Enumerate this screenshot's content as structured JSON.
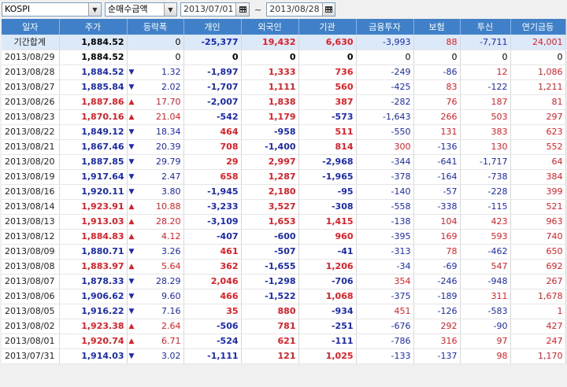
{
  "toolbar": {
    "market": "KOSPI",
    "metric": "순매수금액",
    "start_date": "2013/07/01",
    "end_date": "2013/08/28",
    "range_sep": "~"
  },
  "columns": [
    "일자",
    "주가",
    "등락폭",
    "개인",
    "외국인",
    "기관",
    "금융투자",
    "보험",
    "투신",
    "연기금등"
  ],
  "rows": [
    {
      "date": "기간합계",
      "price": "1,884.52",
      "dir": "",
      "chg": "0",
      "ind": "-25,377",
      "frn": "19,432",
      "inst": "6,630",
      "fin": "-3,993",
      "ins": "88",
      "trust": "-7,711",
      "pen": "24,001",
      "sum": true
    },
    {
      "date": "2013/08/29",
      "price": "1,884.52",
      "dir": "",
      "chg": "0",
      "ind": "0",
      "frn": "0",
      "inst": "0",
      "fin": "0",
      "ins": "0",
      "trust": "0",
      "pen": "0"
    },
    {
      "date": "2013/08/28",
      "price": "1,884.52",
      "dir": "d",
      "chg": "1.32",
      "ind": "-1,897",
      "frn": "1,333",
      "inst": "736",
      "fin": "-249",
      "ins": "-86",
      "trust": "12",
      "pen": "1,086"
    },
    {
      "date": "2013/08/27",
      "price": "1,885.84",
      "dir": "d",
      "chg": "2.02",
      "ind": "-1,707",
      "frn": "1,111",
      "inst": "560",
      "fin": "-425",
      "ins": "83",
      "trust": "-122",
      "pen": "1,211"
    },
    {
      "date": "2013/08/26",
      "price": "1,887.86",
      "dir": "u",
      "chg": "17.70",
      "ind": "-2,007",
      "frn": "1,838",
      "inst": "387",
      "fin": "-282",
      "ins": "76",
      "trust": "187",
      "pen": "81"
    },
    {
      "date": "2013/08/23",
      "price": "1,870.16",
      "dir": "u",
      "chg": "21.04",
      "ind": "-542",
      "frn": "1,179",
      "inst": "-573",
      "fin": "-1,643",
      "ins": "266",
      "trust": "503",
      "pen": "297"
    },
    {
      "date": "2013/08/22",
      "price": "1,849.12",
      "dir": "d",
      "chg": "18.34",
      "ind": "464",
      "frn": "-958",
      "inst": "511",
      "fin": "-550",
      "ins": "131",
      "trust": "383",
      "pen": "623"
    },
    {
      "date": "2013/08/21",
      "price": "1,867.46",
      "dir": "d",
      "chg": "20.39",
      "ind": "708",
      "frn": "-1,400",
      "inst": "814",
      "fin": "300",
      "ins": "-136",
      "trust": "130",
      "pen": "552"
    },
    {
      "date": "2013/08/20",
      "price": "1,887.85",
      "dir": "d",
      "chg": "29.79",
      "ind": "29",
      "frn": "2,997",
      "inst": "-2,968",
      "fin": "-344",
      "ins": "-641",
      "trust": "-1,717",
      "pen": "64"
    },
    {
      "date": "2013/08/19",
      "price": "1,917.64",
      "dir": "d",
      "chg": "2.47",
      "ind": "658",
      "frn": "1,287",
      "inst": "-1,965",
      "fin": "-378",
      "ins": "-164",
      "trust": "-738",
      "pen": "384"
    },
    {
      "date": "2013/08/16",
      "price": "1,920.11",
      "dir": "d",
      "chg": "3.80",
      "ind": "-1,945",
      "frn": "2,180",
      "inst": "-95",
      "fin": "-140",
      "ins": "-57",
      "trust": "-228",
      "pen": "399"
    },
    {
      "date": "2013/08/14",
      "price": "1,923.91",
      "dir": "u",
      "chg": "10.88",
      "ind": "-3,233",
      "frn": "3,527",
      "inst": "-308",
      "fin": "-558",
      "ins": "-338",
      "trust": "-115",
      "pen": "521"
    },
    {
      "date": "2013/08/13",
      "price": "1,913.03",
      "dir": "u",
      "chg": "28.20",
      "ind": "-3,109",
      "frn": "1,653",
      "inst": "1,415",
      "fin": "-138",
      "ins": "104",
      "trust": "423",
      "pen": "963"
    },
    {
      "date": "2013/08/12",
      "price": "1,884.83",
      "dir": "u",
      "chg": "4.12",
      "ind": "-407",
      "frn": "-600",
      "inst": "960",
      "fin": "-395",
      "ins": "169",
      "trust": "593",
      "pen": "740"
    },
    {
      "date": "2013/08/09",
      "price": "1,880.71",
      "dir": "d",
      "chg": "3.26",
      "ind": "461",
      "frn": "-507",
      "inst": "-41",
      "fin": "-313",
      "ins": "78",
      "trust": "-462",
      "pen": "650"
    },
    {
      "date": "2013/08/08",
      "price": "1,883.97",
      "dir": "u",
      "chg": "5.64",
      "ind": "362",
      "frn": "-1,655",
      "inst": "1,206",
      "fin": "-34",
      "ins": "-69",
      "trust": "547",
      "pen": "692"
    },
    {
      "date": "2013/08/07",
      "price": "1,878.33",
      "dir": "d",
      "chg": "28.29",
      "ind": "2,046",
      "frn": "-1,298",
      "inst": "-706",
      "fin": "354",
      "ins": "-246",
      "trust": "-948",
      "pen": "267"
    },
    {
      "date": "2013/08/06",
      "price": "1,906.62",
      "dir": "d",
      "chg": "9.60",
      "ind": "466",
      "frn": "-1,522",
      "inst": "1,068",
      "fin": "-375",
      "ins": "-189",
      "trust": "311",
      "pen": "1,678"
    },
    {
      "date": "2013/08/05",
      "price": "1,916.22",
      "dir": "d",
      "chg": "7.16",
      "ind": "35",
      "frn": "880",
      "inst": "-934",
      "fin": "451",
      "ins": "-126",
      "trust": "-583",
      "pen": "1"
    },
    {
      "date": "2013/08/02",
      "price": "1,923.38",
      "dir": "u",
      "chg": "2.64",
      "ind": "-506",
      "frn": "781",
      "inst": "-251",
      "fin": "-676",
      "ins": "292",
      "trust": "-90",
      "pen": "427"
    },
    {
      "date": "2013/08/01",
      "price": "1,920.74",
      "dir": "u",
      "chg": "6.71",
      "ind": "-524",
      "frn": "621",
      "inst": "-111",
      "fin": "-786",
      "ins": "316",
      "trust": "97",
      "pen": "247"
    },
    {
      "date": "2013/07/31",
      "price": "1,914.03",
      "dir": "d",
      "chg": "3.02",
      "ind": "-1,111",
      "frn": "121",
      "inst": "1,025",
      "fin": "-133",
      "ins": "-137",
      "trust": "98",
      "pen": "1,170"
    }
  ],
  "icons": {
    "dropdown": "chevron-down-icon",
    "calendar": "calendar-icon",
    "up": "triangle-up-icon",
    "down": "triangle-down-icon"
  },
  "colors": {
    "header_bg": "#3f80c9",
    "up": "#e21c23",
    "down": "#1a2ab0",
    "summary_bg": "#dce9f8"
  }
}
